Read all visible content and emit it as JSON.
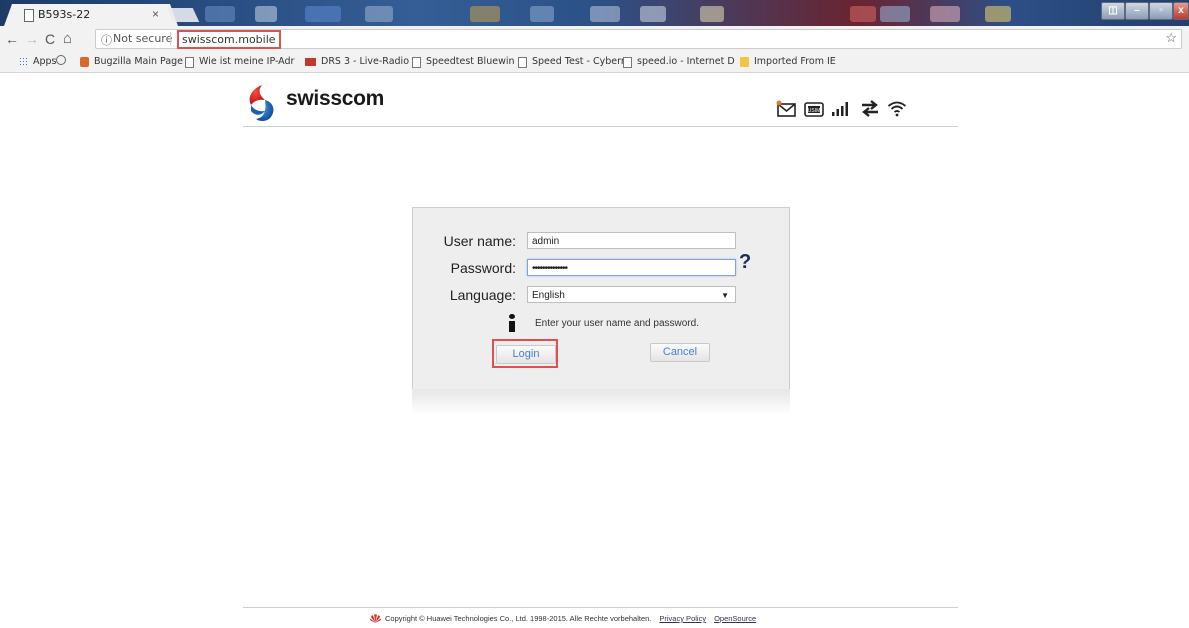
{
  "browser": {
    "tab_title": "B593s-22",
    "tab_close": "×",
    "security_text": "Not secure",
    "url": "swisscom.mobile",
    "bookmarks": [
      {
        "label": "Apps",
        "icon": "apps-grid-icon"
      },
      {
        "label": "",
        "icon": "history-clock-icon"
      },
      {
        "label": "Bugzilla Main Page",
        "icon": "bugzilla-icon"
      },
      {
        "label": "Wie ist meine IP-Adr",
        "icon": "page-icon"
      },
      {
        "label": "DRS 3 - Live-Radio",
        "icon": "srf-icon"
      },
      {
        "label": "Speedtest Bluewin",
        "icon": "page-icon"
      },
      {
        "label": "Speed Test - Cyberr",
        "icon": "page-icon"
      },
      {
        "label": "speed.io - Internet D",
        "icon": "page-icon"
      },
      {
        "label": "Imported From IE",
        "icon": "folder-icon"
      }
    ]
  },
  "header": {
    "brand": "swisscom",
    "status_icons": [
      "new-message-icon",
      "usim-icon",
      "signal-strength-icon",
      "data-transfer-icon",
      "wifi-icon"
    ],
    "usim_label": "USIM"
  },
  "login": {
    "username_label": "User name:",
    "username_value": "admin",
    "password_label": "Password:",
    "password_value": "••••••••••••••",
    "help": "?",
    "language_label": "Language:",
    "language_value": "English",
    "info_message": "Enter your user name and password.",
    "login_button": "Login",
    "cancel_button": "Cancel"
  },
  "footer": {
    "copyright": "Copyright © Huawei Technologies Co., Ltd. 1998-2015. Alle Rechte vorbehalten.",
    "privacy_link": "Privacy Policy",
    "opensource_link": "OpenSource"
  },
  "colors": {
    "accent_red": "#e05050",
    "button_text": "#4a7fc1",
    "help_icon": "#1a2d52"
  }
}
